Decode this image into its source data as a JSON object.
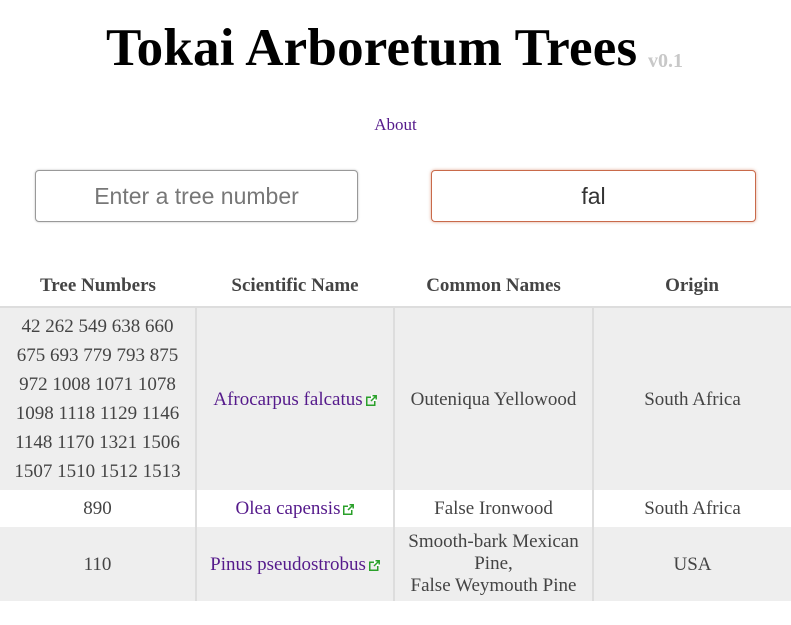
{
  "header": {
    "title": "Tokai Arboretum Trees",
    "version": "v0.1"
  },
  "nav": {
    "about_label": "About"
  },
  "search": {
    "tree_number_placeholder": "Enter a tree number",
    "tree_number_value": "",
    "name_value": "fal"
  },
  "table": {
    "columns": [
      "Tree Numbers",
      "Scientific Name",
      "Common Names",
      "Origin"
    ],
    "rows": [
      {
        "tree_numbers_lines": [
          "42 262 549 638 660",
          "675 693 779 793 875",
          "972 1008 1071 1078",
          "1098 1118 1129 1146",
          "1148 1170 1321 1506",
          "1507 1510 1512 1513"
        ],
        "scientific_name": "Afrocarpus falcatus",
        "common_names_lines": [
          "Outeniqua Yellowood"
        ],
        "origin": "South Africa"
      },
      {
        "tree_numbers_lines": [
          "890"
        ],
        "scientific_name": "Olea capensis",
        "common_names_lines": [
          "False Ironwood"
        ],
        "origin": "South Africa"
      },
      {
        "tree_numbers_lines": [
          "110"
        ],
        "scientific_name": "Pinus pseudostrobus",
        "common_names_lines": [
          "Smooth-bark Mexican Pine,",
          "False Weymouth Pine"
        ],
        "origin": "USA"
      }
    ]
  },
  "colors": {
    "link": "#551a8b",
    "external_icon": "#2aa02a",
    "active_input_border": "#c96a4a",
    "row_stripe": "#eeeeee"
  },
  "icons": {
    "external_link": "external-link-icon"
  }
}
